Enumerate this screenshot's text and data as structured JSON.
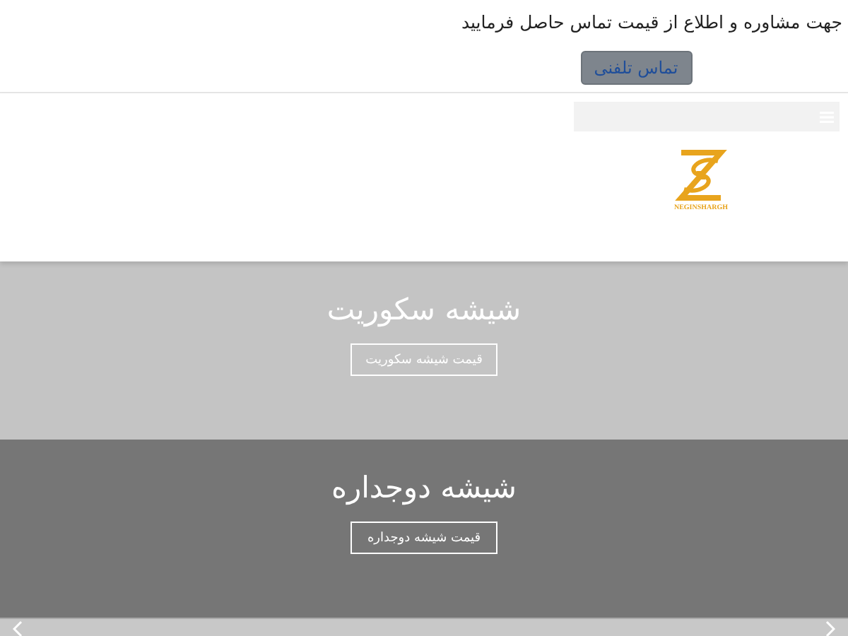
{
  "contact": {
    "text": "جهت مشاوره و اطلاع از قیمت تماس حاصل فرمایید",
    "button": "تماس تلفنی"
  },
  "logo": {
    "text": "NEGINSHARGH"
  },
  "banners": [
    {
      "title": "شیشه سکوریت",
      "button": "قیمت شیشه سکوریت",
      "color": "#c4c4c4"
    },
    {
      "title": "شیشه دوجداره",
      "button": "قیمت شیشه دوجداره",
      "color": "#767676"
    }
  ]
}
